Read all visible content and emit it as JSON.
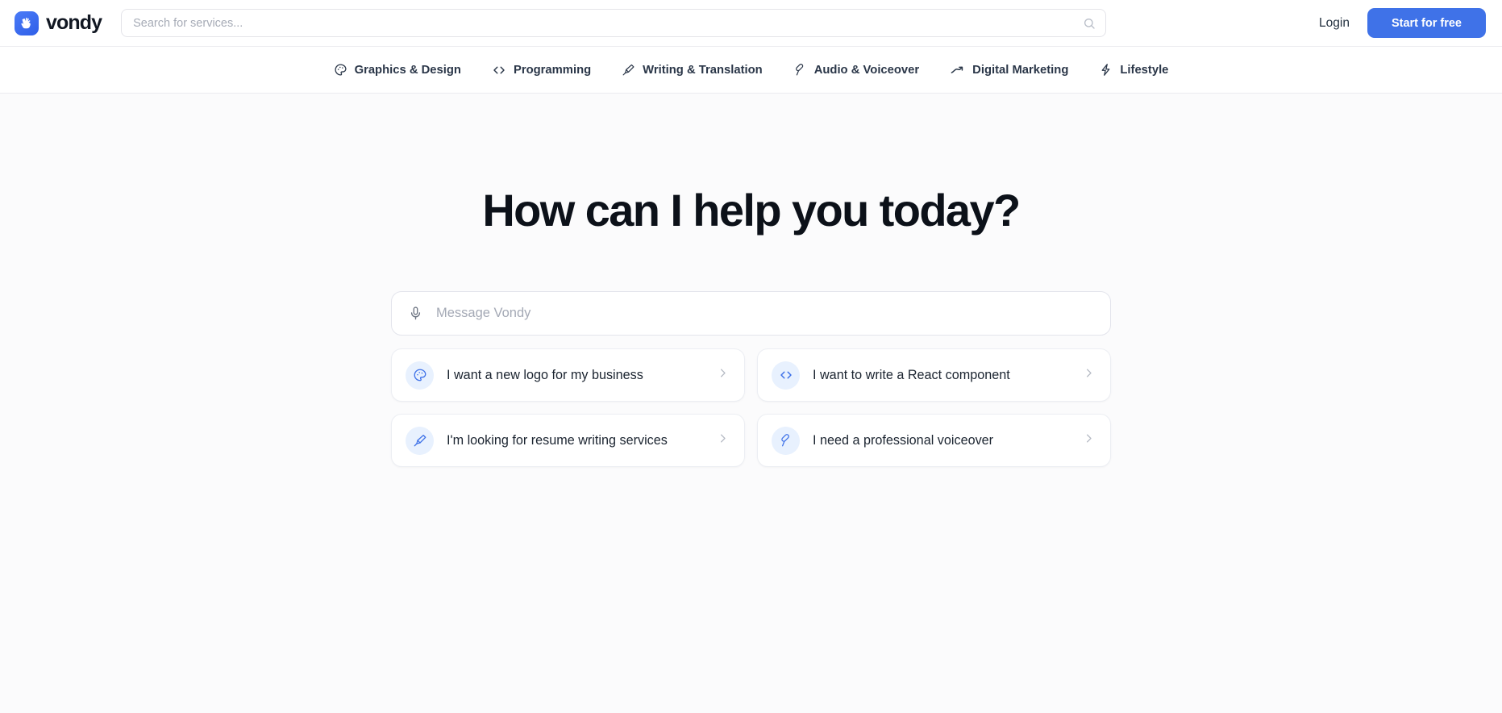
{
  "brand": {
    "name": "vondy",
    "logo_icon": "shaka-hand-icon",
    "logo_color": "#3f72e8"
  },
  "header": {
    "search": {
      "placeholder": "Search for services...",
      "value": "",
      "icon": "search-icon"
    },
    "login_label": "Login",
    "cta_label": "Start for free",
    "cta_color": "#3f72e8"
  },
  "nav": {
    "items": [
      {
        "label": "Graphics & Design",
        "icon": "palette-icon"
      },
      {
        "label": "Programming",
        "icon": "code-brackets-icon"
      },
      {
        "label": "Writing & Translation",
        "icon": "pen-nib-icon"
      },
      {
        "label": "Audio & Voiceover",
        "icon": "microphone-icon"
      },
      {
        "label": "Digital Marketing",
        "icon": "trending-up-icon"
      },
      {
        "label": "Lifestyle",
        "icon": "lightning-bolt-icon"
      }
    ]
  },
  "main": {
    "title": "How can I help you today?",
    "composer": {
      "placeholder": "Message Vondy",
      "value": "",
      "mic_icon": "microphone-icon"
    },
    "suggestions": [
      {
        "label": "I want a new logo for my business",
        "icon": "palette-icon",
        "chevron": "chevron-right-icon"
      },
      {
        "label": "I want to write a React component",
        "icon": "code-brackets-icon",
        "chevron": "chevron-right-icon"
      },
      {
        "label": "I'm looking for resume writing services",
        "icon": "pen-nib-icon",
        "chevron": "chevron-right-icon"
      },
      {
        "label": "I need a professional voiceover",
        "icon": "microphone-icon",
        "chevron": "chevron-right-icon"
      }
    ]
  }
}
